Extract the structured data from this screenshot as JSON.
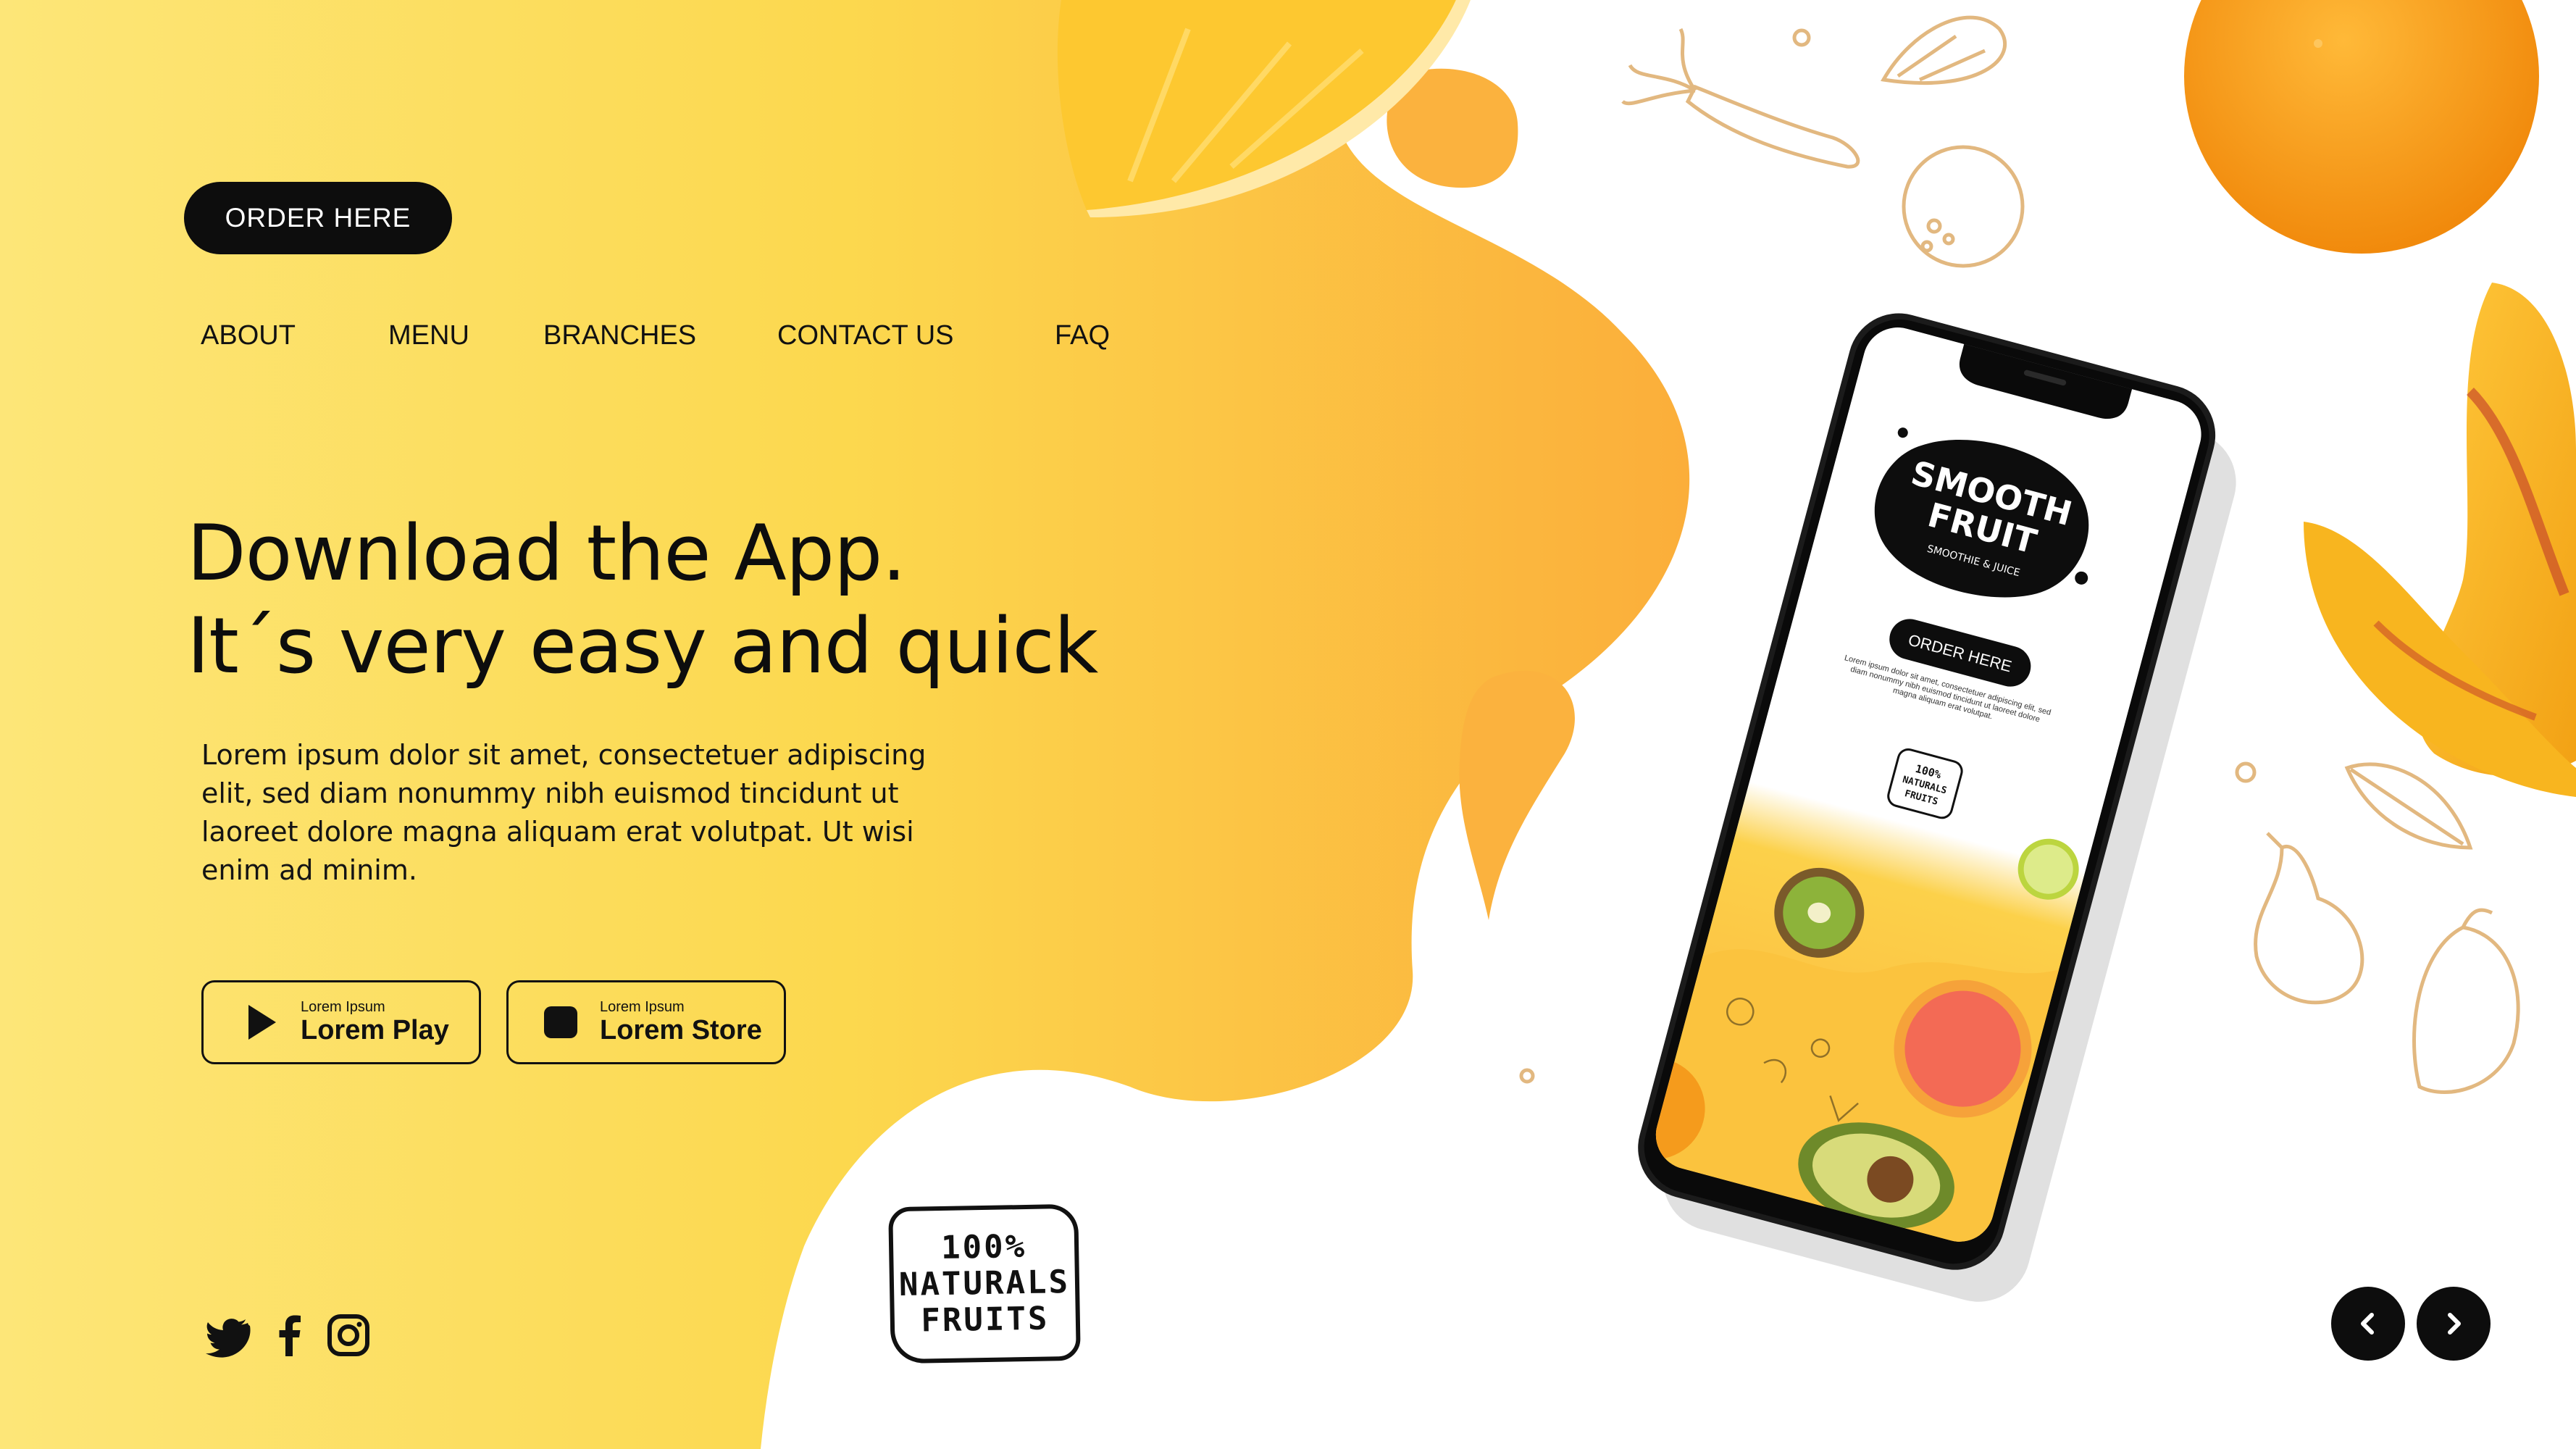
{
  "header": {
    "order_label": "ORDER HERE"
  },
  "nav": {
    "items": [
      "ABOUT",
      "MENU",
      "BRANCHES",
      "CONTACT US",
      "FAQ"
    ]
  },
  "hero": {
    "headline_line1": "Download the App.",
    "headline_line2": "It´s very easy and quick",
    "paragraph": "Lorem ipsum dolor sit amet, consectetuer adipiscing elit, sed diam nonummy nibh euismod tincidunt ut laoreet dolore magna aliquam erat volutpat. Ut wisi enim ad minim."
  },
  "stores": [
    {
      "small": "Lorem Ipsum",
      "big": "Lorem Play",
      "icon": "play-icon"
    },
    {
      "small": "Lorem Ipsum",
      "big": "Lorem Store",
      "icon": "apple-icon"
    }
  ],
  "badge": {
    "lines": [
      "100%",
      "NATURALS",
      "FRUITS"
    ]
  },
  "social": [
    "twitter-icon",
    "facebook-icon",
    "instagram-icon"
  ],
  "carousel": {
    "prev": "chevron-left-icon",
    "next": "chevron-right-icon"
  },
  "phone": {
    "logo_line1": "SMOOTH",
    "logo_line2": "FRUIT",
    "logo_sub": "SMOOTHIE & JUICE",
    "order_label": "ORDER HERE",
    "text": "Lorem ipsum dolor sit amet, consectetuer adipiscing elit, sed diam nonummy nibh euismod tincidunt ut laoreet dolore magna aliquam erat volutpat.",
    "badge_lines": [
      "100%",
      "NATURALS",
      "FRUITS"
    ]
  },
  "colors": {
    "yellow_light": "#FCE46E",
    "yellow": "#FCD24A",
    "orange": "#FBAE38",
    "dark": "#0D0D0D",
    "white": "#FFFFFF",
    "doodle": "#E2B880"
  }
}
